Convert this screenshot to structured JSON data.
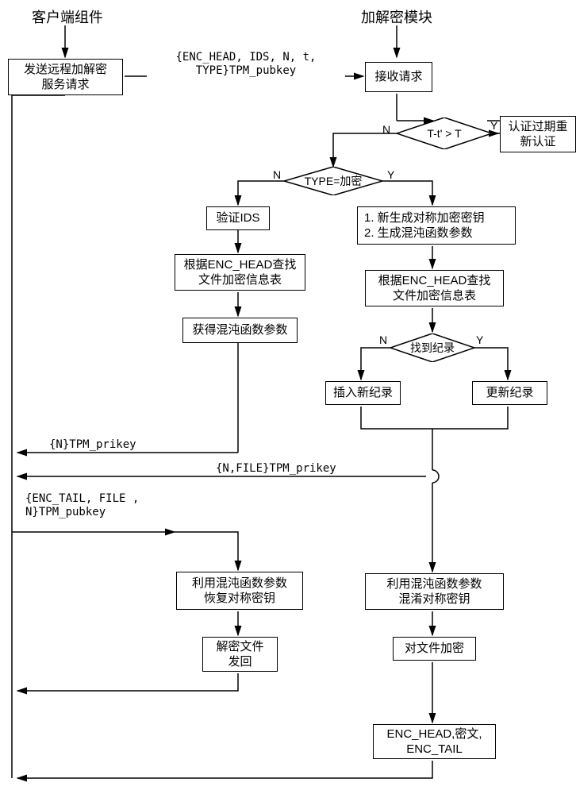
{
  "header": {
    "client": "客户端组件",
    "crypto": "加解密模块"
  },
  "client": {
    "sendReq": "发送远程加解密\n服务请求"
  },
  "server": {
    "receive": "接收请求",
    "expired": "认证过期重\n新认证",
    "verifyIDS": "验证IDS",
    "lookupDec": "根据ENC_HEAD查找\n文件加密信息表",
    "getChaos": "获得混沌函数参数",
    "genKeys": "1. 新生成对称加密密钥\n2. 生成混沌函数参数",
    "lookupEnc": "根据ENC_HEAD查找\n文件加密信息表",
    "insert": "插入新纪录",
    "update": "更新纪录",
    "recoverKey": "利用混沌函数参数\n恢复对称密钥",
    "decryptSend": "解密文件\n发回",
    "chaosKey": "利用混沌函数参数\n混淆对称密钥",
    "encryptFile": "对文件加密",
    "output": "ENC_HEAD,密文,\nENC_TAIL"
  },
  "decisions": {
    "timeout": "T-t' > T",
    "typeEnc": "TYPE=加密",
    "found": "找到纪录"
  },
  "yn": {
    "y": "Y",
    "n": "N"
  },
  "msgs": {
    "req": "{ENC_HEAD, IDS, N, t,\nTYPE}TPM_pubkey",
    "nprikey": "{N}TPM_prikey",
    "nfile": "{N,FILE}TPM_prikey",
    "enctail": "{ENC_TAIL, FILE\n , N}TPM_pubkey"
  },
  "chart_data": {
    "type": "flowchart",
    "swimlanes": [
      "客户端组件",
      "加解密模块"
    ],
    "nodes": [
      {
        "id": "sendReq",
        "lane": 0,
        "type": "process",
        "label": "发送远程加解密服务请求"
      },
      {
        "id": "receive",
        "lane": 1,
        "type": "process",
        "label": "接收请求"
      },
      {
        "id": "timeout",
        "lane": 1,
        "type": "decision",
        "label": "T-t' > T"
      },
      {
        "id": "expired",
        "lane": 1,
        "type": "process",
        "label": "认证过期重新认证"
      },
      {
        "id": "typeEnc",
        "lane": 1,
        "type": "decision",
        "label": "TYPE=加密"
      },
      {
        "id": "verifyIDS",
        "lane": 1,
        "type": "process",
        "label": "验证IDS"
      },
      {
        "id": "lookupDec",
        "lane": 1,
        "type": "process",
        "label": "根据ENC_HEAD查找文件加密信息表"
      },
      {
        "id": "getChaos",
        "lane": 1,
        "type": "process",
        "label": "获得混沌函数参数"
      },
      {
        "id": "genKeys",
        "lane": 1,
        "type": "process",
        "label": "1. 新生成对称加密密钥 2. 生成混沌函数参数"
      },
      {
        "id": "lookupEnc",
        "lane": 1,
        "type": "process",
        "label": "根据ENC_HEAD查找文件加密信息表"
      },
      {
        "id": "found",
        "lane": 1,
        "type": "decision",
        "label": "找到纪录"
      },
      {
        "id": "insert",
        "lane": 1,
        "type": "process",
        "label": "插入新纪录"
      },
      {
        "id": "update",
        "lane": 1,
        "type": "process",
        "label": "更新纪录"
      },
      {
        "id": "recoverKey",
        "lane": 1,
        "type": "process",
        "label": "利用混沌函数参数恢复对称密钥"
      },
      {
        "id": "decryptSend",
        "lane": 1,
        "type": "process",
        "label": "解密文件发回"
      },
      {
        "id": "chaosKey",
        "lane": 1,
        "type": "process",
        "label": "利用混沌函数参数混淆对称密钥"
      },
      {
        "id": "encryptFile",
        "lane": 1,
        "type": "process",
        "label": "对文件加密"
      },
      {
        "id": "output",
        "lane": 1,
        "type": "process",
        "label": "ENC_HEAD,密文,ENC_TAIL"
      }
    ],
    "edges": [
      {
        "from": "sendReq",
        "to": "receive",
        "label": "{ENC_HEAD, IDS, N, t, TYPE}TPM_pubkey"
      },
      {
        "from": "receive",
        "to": "timeout"
      },
      {
        "from": "timeout",
        "to": "expired",
        "label": "Y"
      },
      {
        "from": "timeout",
        "to": "typeEnc",
        "label": "N"
      },
      {
        "from": "typeEnc",
        "to": "genKeys",
        "label": "Y"
      },
      {
        "from": "typeEnc",
        "to": "verifyIDS",
        "label": "N"
      },
      {
        "from": "verifyIDS",
        "to": "lookupDec"
      },
      {
        "from": "lookupDec",
        "to": "getChaos"
      },
      {
        "from": "genKeys",
        "to": "lookupEnc"
      },
      {
        "from": "lookupEnc",
        "to": "found"
      },
      {
        "from": "found",
        "to": "insert",
        "label": "N"
      },
      {
        "from": "found",
        "to": "update",
        "label": "Y"
      },
      {
        "from": "getChaos",
        "to": "sendReq",
        "label": "{N}TPM_prikey"
      },
      {
        "from": "sendReq",
        "to": "recoverKey",
        "label": "{ENC_TAIL, FILE, N}TPM_pubkey"
      },
      {
        "from": "insert",
        "to": "sendReq",
        "label": "{N,FILE}TPM_prikey (via jump)"
      },
      {
        "from": "update",
        "to": "sendReq",
        "label": "{N,FILE}TPM_prikey (via jump)"
      },
      {
        "from": "recoverKey",
        "to": "decryptSend"
      },
      {
        "from": "decryptSend",
        "to": "client"
      },
      {
        "from": "chaosKey",
        "to": "encryptFile"
      },
      {
        "from": "encryptFile",
        "to": "output"
      },
      {
        "from": "output",
        "to": "client"
      }
    ]
  }
}
